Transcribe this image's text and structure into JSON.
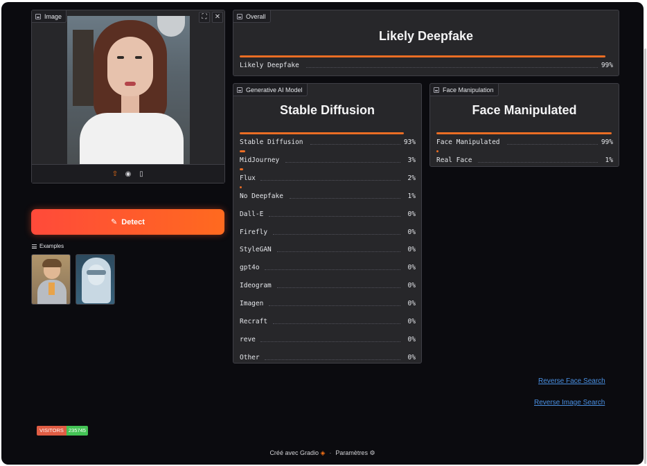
{
  "image_block": {
    "label": "Image",
    "fullscreen_icon": "fullscreen-icon",
    "close_icon": "close-icon",
    "footer_icons": [
      "upload-icon",
      "webcam-icon",
      "clipboard-icon"
    ]
  },
  "detect_button": {
    "label": "Detect",
    "icon": "magic-wand-icon"
  },
  "examples": {
    "label": "Examples",
    "items": [
      "example-child-ice-cream",
      "example-silver-hair-visor"
    ]
  },
  "overall": {
    "label": "Overall",
    "title": "Likely Deepfake",
    "rows": [
      {
        "name": "Likely Deepfake",
        "pct": "99%",
        "value": 0.99
      }
    ]
  },
  "generative_model": {
    "label": "Generative AI Model",
    "title": "Stable Diffusion",
    "rows": [
      {
        "name": "Stable Diffusion",
        "pct": "93%",
        "value": 0.93
      },
      {
        "name": "MidJourney",
        "pct": "3%",
        "value": 0.03
      },
      {
        "name": "Flux",
        "pct": "2%",
        "value": 0.02
      },
      {
        "name": "No Deepfake",
        "pct": "1%",
        "value": 0.01
      },
      {
        "name": "Dall-E",
        "pct": "0%",
        "value": 0
      },
      {
        "name": "Firefly",
        "pct": "0%",
        "value": 0
      },
      {
        "name": "StyleGAN",
        "pct": "0%",
        "value": 0
      },
      {
        "name": "gpt4o",
        "pct": "0%",
        "value": 0
      },
      {
        "name": "Ideogram",
        "pct": "0%",
        "value": 0
      },
      {
        "name": "Imagen",
        "pct": "0%",
        "value": 0
      },
      {
        "name": "Recraft",
        "pct": "0%",
        "value": 0
      },
      {
        "name": "reve",
        "pct": "0%",
        "value": 0
      },
      {
        "name": "Other",
        "pct": "0%",
        "value": 0
      }
    ]
  },
  "face_manipulation": {
    "label": "Face Manipulation",
    "title": "Face Manipulated",
    "rows": [
      {
        "name": "Face Manipulated",
        "pct": "99%",
        "value": 0.99
      },
      {
        "name": "Real Face",
        "pct": "1%",
        "value": 0.01
      }
    ]
  },
  "links": {
    "reverse_face": "Reverse Face Search",
    "reverse_image": "Reverse Image Search"
  },
  "visitors": {
    "label": "VISITORS",
    "count": "235745"
  },
  "footer": {
    "built_with": "Créé avec Gradio",
    "separator": "·",
    "settings": "Paramètres"
  },
  "colors": {
    "accent": "#ea6d24",
    "link": "#4a90e2",
    "background": "#0b0b0f",
    "panel": "#27272a"
  }
}
